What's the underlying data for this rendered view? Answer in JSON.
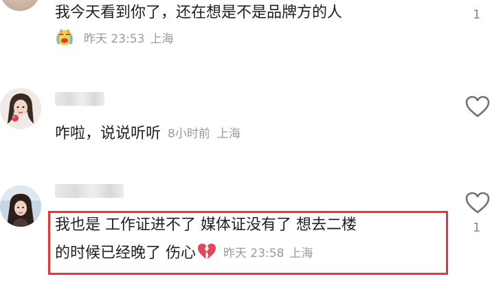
{
  "comments": [
    {
      "text": "我今天看到你了，还在想是不是品牌方的人",
      "time": "昨天 23:53",
      "location": "上海",
      "likes": "1",
      "emoji": "crying-face-emoji"
    },
    {
      "text": "咋啦，说说听听",
      "time": "8小时前",
      "location": "上海",
      "icon": "heart-outline-icon"
    },
    {
      "line1": "我也是 工作证进不了 媒体证没有了 想去二楼",
      "line2": "的时候已经晚了 伤心",
      "emoji": "broken-heart-emoji",
      "time": "昨天 23:58",
      "location": "上海",
      "likes": "1",
      "icon": "heart-outline-icon"
    }
  ],
  "colors": {
    "highlight": "#e8323a",
    "meta": "#9a9a9a",
    "text": "#1e1e1e"
  }
}
